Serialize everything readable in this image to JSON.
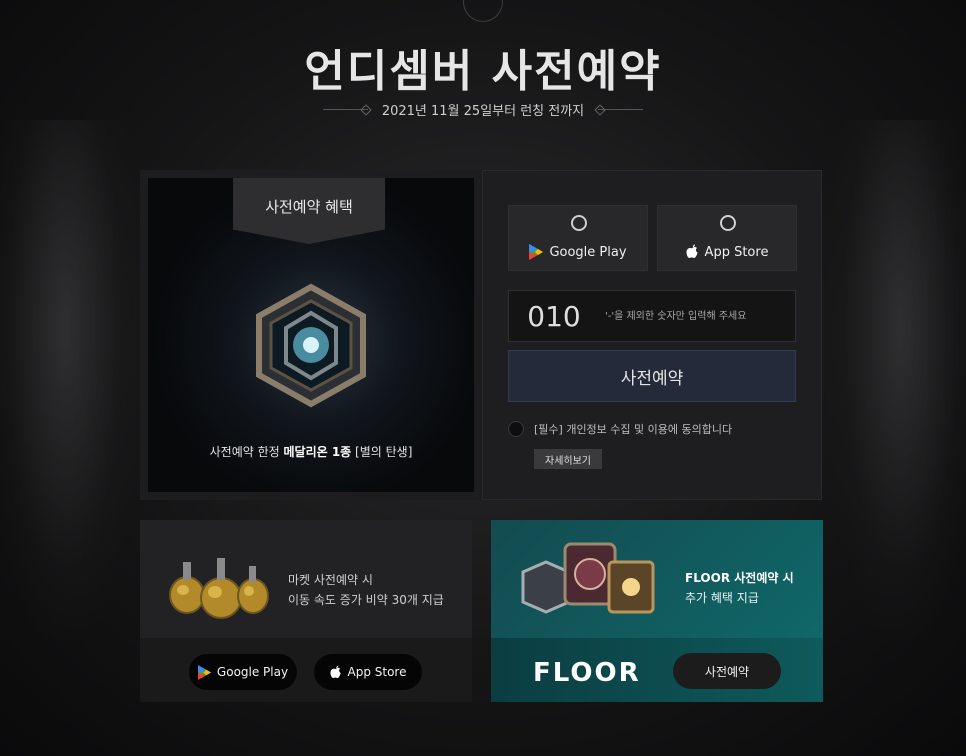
{
  "header": {
    "title": "언디셈버 사전예약",
    "subtitle": "2021년 11월 25일부터 런칭 전까지"
  },
  "reward": {
    "banner_label": "사전예약 혜택",
    "caption_prefix": "사전예약 한정 ",
    "caption_highlight": "메달리온 1종",
    "caption_suffix": " [별의 탄생]"
  },
  "form": {
    "stores": [
      {
        "label": "Google Play",
        "icon": "google-play-icon",
        "selected": false
      },
      {
        "label": "App Store",
        "icon": "apple-icon",
        "selected": false
      }
    ],
    "phone_prefix": "010",
    "phone_placeholder": "'-'을 제외한 숫자만 입력해 주세요",
    "phone_value": "",
    "submit_label": "사전예약",
    "agree_text": "[필수] 개인정보 수집 및 이용에 동의합니다",
    "agree_checked": false,
    "detail_button": "자세히보기"
  },
  "market": {
    "line1": "마켓 사전예약 시",
    "line2": "이동 속도 증가 비약 30개 지급",
    "google_play_label": "Google Play",
    "app_store_label": "App Store"
  },
  "floor": {
    "line1": "FLOOR 사전예약 시",
    "line2": "추가 혜택 지급",
    "logo": "FLOOR",
    "button_label": "사전예약"
  },
  "colors": {
    "accent_button": "#252a3a",
    "floor_teal": "#0f6b6c",
    "background": "#151516"
  }
}
